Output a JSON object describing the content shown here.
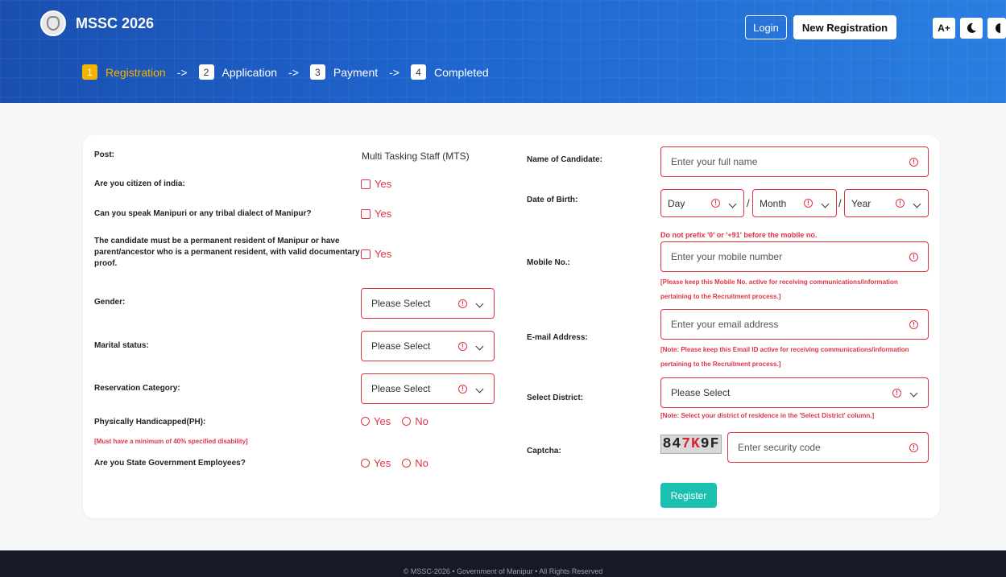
{
  "header": {
    "brand": "MSSC 2026",
    "login_label": "Login",
    "new_registration_label": "New Registration",
    "font_size_label": "A+",
    "steps": [
      {
        "num": "1",
        "label": "Registration"
      },
      {
        "num": "2",
        "label": "Application"
      },
      {
        "num": "3",
        "label": "Payment"
      },
      {
        "num": "4",
        "label": "Completed"
      }
    ],
    "arrow": "->"
  },
  "left": {
    "post_label": "Post:",
    "post_value": "Multi Tasking Staff (MTS)",
    "citizen_label": "Are you citizen of india:",
    "citizen_yes": "Yes",
    "dialect_label": "Can you speak Manipuri or any tribal dialect of Manipur?",
    "dialect_yes": "Yes",
    "resident_label": "The candidate must be a permanent resident of Manipur or have parent/ancestor who is a permanent resident, with valid documentary proof.",
    "resident_yes": "Yes",
    "gender_label": "Gender:",
    "gender_value": "Please Select",
    "marital_label": "Marital status:",
    "marital_value": "Please Select",
    "reservation_label": "Reservation Category:",
    "reservation_value": "Please Select",
    "ph_label": "Physically Handicapped(PH):",
    "ph_yes": "Yes",
    "ph_no": "No",
    "ph_note": "[Must have a minimum of 40% specified disability]",
    "stategov_label": "Are you State Government Employees?",
    "stategov_yes": "Yes",
    "stategov_no": "No"
  },
  "right": {
    "name_label": "Name of Candidate:",
    "name_placeholder": "Enter your full name",
    "dob_label": "Date of Birth:",
    "dob_day": "Day",
    "dob_month": "Month",
    "dob_year": "Year",
    "dob_sep": "/",
    "mobile_prefix_note": "Do not prefix '0' or '+91' before the mobile no.",
    "mobile_label": "Mobile No.:",
    "mobile_placeholder": "Enter your mobile number",
    "mobile_note": "[Please keep this Mobile No. active for receiving communications/information pertaining to the Recruitment process.]",
    "email_label": "E-mail Address:",
    "email_placeholder": "Enter your email address",
    "email_note": "[Note: Please keep this Email ID active for receiving communications/information pertaining to the Recruitment process.]",
    "district_label": "Select District:",
    "district_value": "Please Select",
    "district_note": "[Note: Select your district of residence in the 'Select District' column.]",
    "captcha_label": "Captcha:",
    "captcha_text_a": "84",
    "captcha_text_b": "7K",
    "captcha_text_c": "9F",
    "captcha_placeholder": "Enter security code",
    "register_label": "Register"
  },
  "footer": {
    "text": "© MSSC-2026 • Government of Manipur • All Rights Reserved"
  },
  "colors": {
    "header_blue": "#1f66cf",
    "error_red": "#e03344",
    "active_step": "#f5b400",
    "register_teal": "#1cc0b0"
  }
}
